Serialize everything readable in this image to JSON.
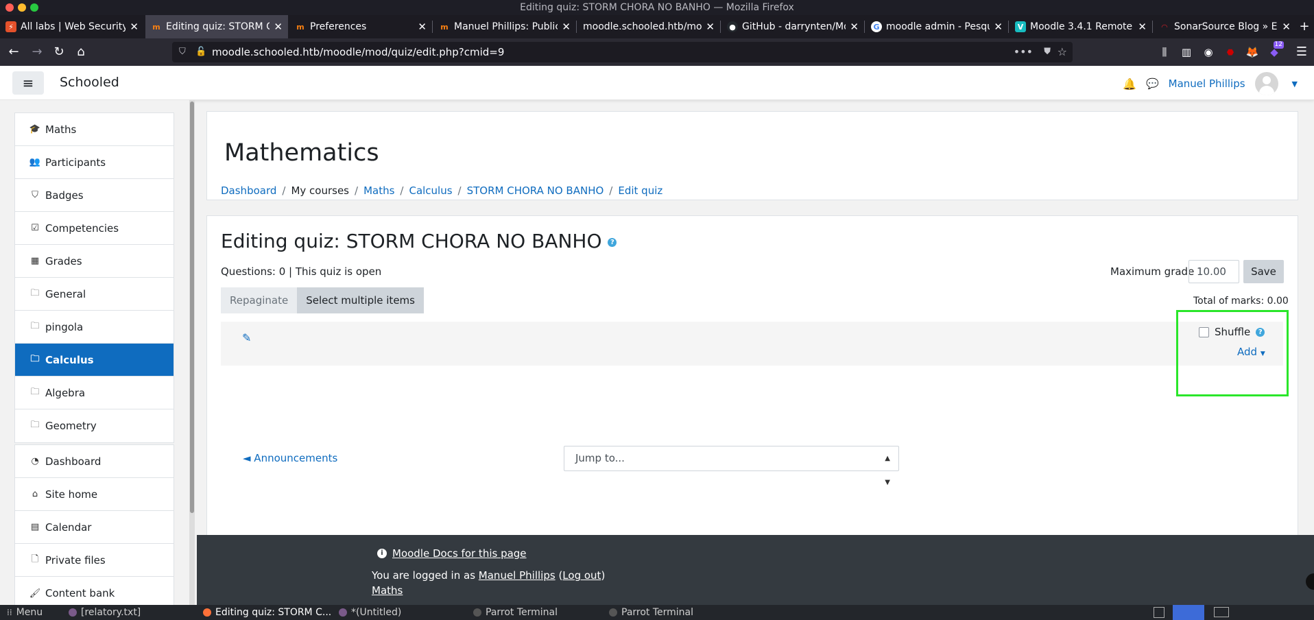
{
  "window": {
    "title": "Editing quiz: STORM CHORA NO BANHO — Mozilla Firefox"
  },
  "tabs": [
    {
      "title": "All labs | Web Security",
      "favicon": "portswigger-icon",
      "color": "#e4512b"
    },
    {
      "title": "Editing quiz: STORM C",
      "favicon": "moodle-icon",
      "color": "#f98012"
    },
    {
      "title": "Preferences",
      "favicon": "moodle-icon",
      "color": "#f98012"
    },
    {
      "title": "Manuel Phillips: Public",
      "favicon": "moodle-icon",
      "color": "#f98012"
    },
    {
      "title": "moodle.schooled.htb/moo",
      "favicon": "none"
    },
    {
      "title": "GitHub - darrynten/Mo",
      "favicon": "github-icon",
      "color": "#ffffff"
    },
    {
      "title": "moodle admin - Pesqu",
      "favicon": "google-icon",
      "color": "#4285f4"
    },
    {
      "title": "Moodle 3.4.1 Remote",
      "favicon": "vulners-icon",
      "color": "#18bcc0"
    },
    {
      "title": "SonarSource Blog » Ev",
      "favicon": "sonarsource-icon",
      "color": "#cb2029"
    }
  ],
  "url": {
    "full": "moodle.schooled.htb/moodle/mod/quiz/edit.php?cmid=9"
  },
  "extension_badge": "12",
  "moodle": {
    "site_name": "Schooled",
    "user_name": "Manuel Phillips"
  },
  "sidebar": {
    "course_items": [
      {
        "label": "Maths",
        "icon": "graduation-cap-icon",
        "glyph": "🎓"
      },
      {
        "label": "Participants",
        "icon": "users-icon",
        "glyph": "👥"
      },
      {
        "label": "Badges",
        "icon": "shield-icon",
        "glyph": "⛉"
      },
      {
        "label": "Competencies",
        "icon": "check-square-icon",
        "glyph": "☑"
      },
      {
        "label": "Grades",
        "icon": "table-icon",
        "glyph": "▦"
      },
      {
        "label": "General",
        "icon": "folder-icon",
        "glyph": "🗀"
      },
      {
        "label": "pingola",
        "icon": "folder-icon",
        "glyph": "🗀"
      },
      {
        "label": "Calculus",
        "icon": "folder-icon",
        "glyph": "🗀",
        "active": true
      },
      {
        "label": "Algebra",
        "icon": "folder-icon",
        "glyph": "🗀"
      },
      {
        "label": "Geometry",
        "icon": "folder-icon",
        "glyph": "🗀"
      }
    ],
    "site_items": [
      {
        "label": "Dashboard",
        "icon": "dashboard-icon",
        "glyph": "◔"
      },
      {
        "label": "Site home",
        "icon": "home-icon",
        "glyph": "⌂"
      },
      {
        "label": "Calendar",
        "icon": "calendar-icon",
        "glyph": "▤"
      },
      {
        "label": "Private files",
        "icon": "file-icon",
        "glyph": "🗋"
      },
      {
        "label": "Content bank",
        "icon": "paintbrush-icon",
        "glyph": "🖌"
      }
    ]
  },
  "header": {
    "course_title": "Mathematics",
    "breadcrumb": [
      {
        "label": "Dashboard",
        "link": true
      },
      {
        "label": "My courses",
        "link": false
      },
      {
        "label": "Maths",
        "link": true
      },
      {
        "label": "Calculus",
        "link": true
      },
      {
        "label": "STORM CHORA NO BANHO",
        "link": true
      },
      {
        "label": "Edit quiz",
        "link": true
      }
    ]
  },
  "quiz": {
    "heading": "Editing quiz: STORM CHORA NO BANHO",
    "status": "Questions: 0 | This quiz is open",
    "max_grade_label": "Maximum grade",
    "max_grade_value": "10.00",
    "save_label": "Save",
    "repaginate_label": "Repaginate",
    "select_multiple_label": "Select multiple items",
    "total_marks": "Total of marks: 0.00",
    "shuffle_label": "Shuffle",
    "add_label": "Add"
  },
  "activity_nav": {
    "prev_label": "◄ Announcements",
    "jump_label": "Jump to..."
  },
  "footer": {
    "docs_link": "Moodle Docs for this page",
    "logged_in_prefix": "You are logged in as",
    "user": "Manuel Phillips",
    "logout": "Log out",
    "course_link": "Maths"
  },
  "taskbar": {
    "menu_label": "Menu",
    "items": [
      {
        "label": "[relatory.txt]"
      },
      {
        "label": "Editing quiz: STORM C..."
      },
      {
        "label": "*(Untitled)"
      },
      {
        "label": "Parrot Terminal"
      },
      {
        "label": "Parrot Terminal"
      }
    ]
  }
}
